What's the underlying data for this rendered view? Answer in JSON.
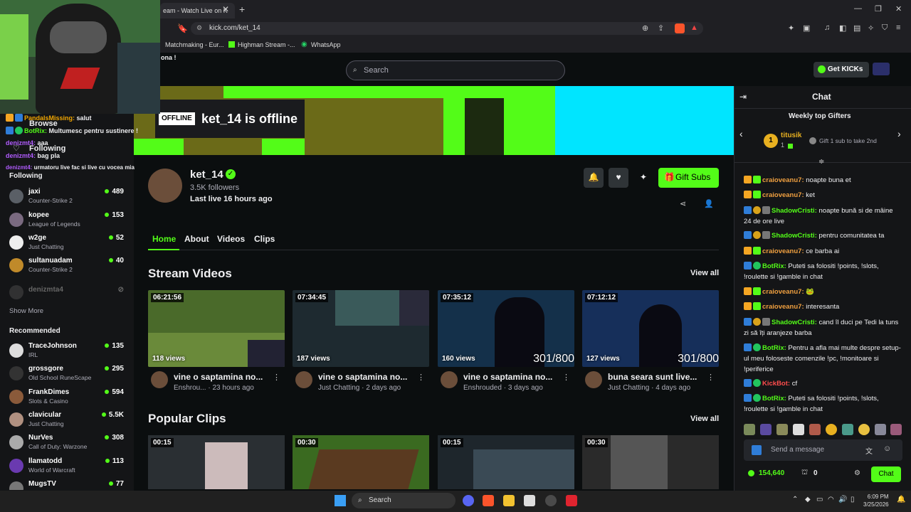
{
  "browser": {
    "tab_title": "eam - Watch Live on K",
    "tab_close": "✕",
    "new_tab": "+",
    "url": "kick.com/ket_14",
    "bookmarks": [
      "Matchmaking - Eur...",
      "Highman Stream -...",
      "WhatsApp"
    ]
  },
  "header": {
    "search_placeholder": "Search",
    "get_kicks": "Get KICKs",
    "partial_text": "ona !"
  },
  "banner": {
    "offline_tag": "OFFLINE",
    "offline_text": "ket_14 is offline"
  },
  "overlay_chat": [
    {
      "user": "PandalsMissing:",
      "text": "salut",
      "color": "#f0a500"
    },
    {
      "user": "BotRix:",
      "text": "Multumesc pentru sustinere !",
      "color": "#53fc18"
    },
    {
      "user": "denizmt4:",
      "text": "aaa",
      "color": "#b15cff"
    },
    {
      "user": "denizmt4:",
      "text": "bag pla",
      "color": "#b15cff"
    },
    {
      "user": "denizmt4:",
      "text": "urmatoru live fac si live cu vocea mia",
      "color": "#b15cff"
    }
  ],
  "sidebar": {
    "browse": "Browse",
    "following_nav": "Following",
    "following_title": "Following",
    "following": [
      {
        "name": "jaxi",
        "cat": "Counter-Strike 2",
        "count": "489"
      },
      {
        "name": "kopee",
        "cat": "League of Legends",
        "count": "153"
      },
      {
        "name": "w2ge",
        "cat": "Just Chatting",
        "count": "52"
      },
      {
        "name": "sultanuadam",
        "cat": "Counter-Strike 2",
        "count": "40"
      }
    ],
    "offline_user": "denizmta4",
    "show_more": "Show More",
    "recommended_title": "Recommended",
    "recommended": [
      {
        "name": "TraceJohnson",
        "cat": "IRL",
        "count": "135"
      },
      {
        "name": "grossgore",
        "cat": "Old School RuneScape",
        "count": "295"
      },
      {
        "name": "FrankDimes",
        "cat": "Slots & Casino",
        "count": "594"
      },
      {
        "name": "clavicular",
        "cat": "Just Chatting",
        "count": "5.5K"
      },
      {
        "name": "NurVes",
        "cat": "Call of Duty: Warzone",
        "count": "308"
      },
      {
        "name": "llamatodd",
        "cat": "World of Warcraft",
        "count": "113"
      },
      {
        "name": "MugsTV",
        "cat": "",
        "count": "77"
      }
    ]
  },
  "profile": {
    "name": "ket_14",
    "followers": "3.5K followers",
    "last_live": "Last live 16 hours ago",
    "gift_subs": "Gift Subs"
  },
  "tabs": [
    "Home",
    "About",
    "Videos",
    "Clips"
  ],
  "stream_videos": {
    "title": "Stream Videos",
    "view_all": "View all",
    "items": [
      {
        "duration": "06:21:56",
        "views": "118 views",
        "frac": "",
        "title": "vine o saptamina no...",
        "category": "Enshrou...",
        "age": "· 23 hours ago"
      },
      {
        "duration": "07:34:45",
        "views": "187 views",
        "frac": "",
        "title": "vine o saptamina no...",
        "category": "Just Chatting",
        "age": "· 2 days ago"
      },
      {
        "duration": "07:35:12",
        "views": "160 views",
        "frac": "301/800",
        "title": "vine o saptamina no...",
        "category": "Enshrouded",
        "age": "· 3 days ago"
      },
      {
        "duration": "07:12:12",
        "views": "127 views",
        "frac": "301/800",
        "title": "buna seara sunt live...",
        "category": "Just Chatting",
        "age": "· 4 days ago"
      }
    ]
  },
  "popular_clips": {
    "title": "Popular Clips",
    "view_all": "View all",
    "durations": [
      "00:15",
      "00:30",
      "00:15",
      "00:30"
    ]
  },
  "chat": {
    "title": "Chat",
    "gifters_title": "Weekly top Gifters",
    "top_gifter": "titusik",
    "top_gifter_count": "1",
    "gift_hint": "Gift 1 sub to take 2nd",
    "messages": [
      {
        "badges": [
          "crown",
          "green"
        ],
        "user": "craioveanu7:",
        "color": "#f0a040",
        "text": "noapte buna et"
      },
      {
        "badges": [
          "crown",
          "green"
        ],
        "user": "craioveanu7:",
        "color": "#f0a040",
        "text": "ket"
      },
      {
        "badges": [
          "blue",
          "gold",
          "gray"
        ],
        "user": "ShadowCristi:",
        "color": "#53fc18",
        "text": "noapte bună si de mâine 24 de ore live"
      },
      {
        "badges": [
          "blue",
          "gold",
          "gray"
        ],
        "user": "ShadowCristi:",
        "color": "#53fc18",
        "text": "pentru comunitatea ta"
      },
      {
        "badges": [
          "crown",
          "green"
        ],
        "user": "craioveanu7:",
        "color": "#f0a040",
        "text": "ce barba ai"
      },
      {
        "badges": [
          "blue",
          "verified"
        ],
        "user": "BotRix:",
        "color": "#53fc18",
        "text": "Puteti sa folositi !points, !slots, !roulette si !gamble in chat"
      },
      {
        "badges": [
          "crown",
          "green"
        ],
        "user": "craioveanu7:",
        "color": "#f0a040",
        "text": "🐸"
      },
      {
        "badges": [
          "crown",
          "green"
        ],
        "user": "craioveanu7:",
        "color": "#f0a040",
        "text": "interesanta"
      },
      {
        "badges": [
          "blue",
          "gold",
          "gray"
        ],
        "user": "ShadowCristi:",
        "color": "#53fc18",
        "text": "cand îl duci pe Tedi la tuns zi să îți aranjeze barba"
      },
      {
        "badges": [
          "blue",
          "verified"
        ],
        "user": "BotRix:",
        "color": "#53fc18",
        "text": "Pentru a afla mai multe despre setup-ul meu foloseste comenzile !pc, !monitoare si !periferice"
      },
      {
        "badges": [
          "blue",
          "verified"
        ],
        "user": "KickBot:",
        "color": "#ff4d4d",
        "text": "cf"
      },
      {
        "badges": [
          "blue",
          "verified"
        ],
        "user": "BotRix:",
        "color": "#53fc18",
        "text": "Puteti sa folositi !points, !slots, !roulette si !gamble in chat"
      }
    ],
    "input_placeholder": "Send a message",
    "points": "154,640",
    "drops": "0",
    "chat_button": "Chat"
  },
  "taskbar": {
    "search": "Search",
    "time": "6:09 PM",
    "date": "3/25/2026"
  },
  "colors": {
    "kick_green": "#53fc18",
    "bg": "#0b0e0f",
    "panel": "#141517"
  }
}
